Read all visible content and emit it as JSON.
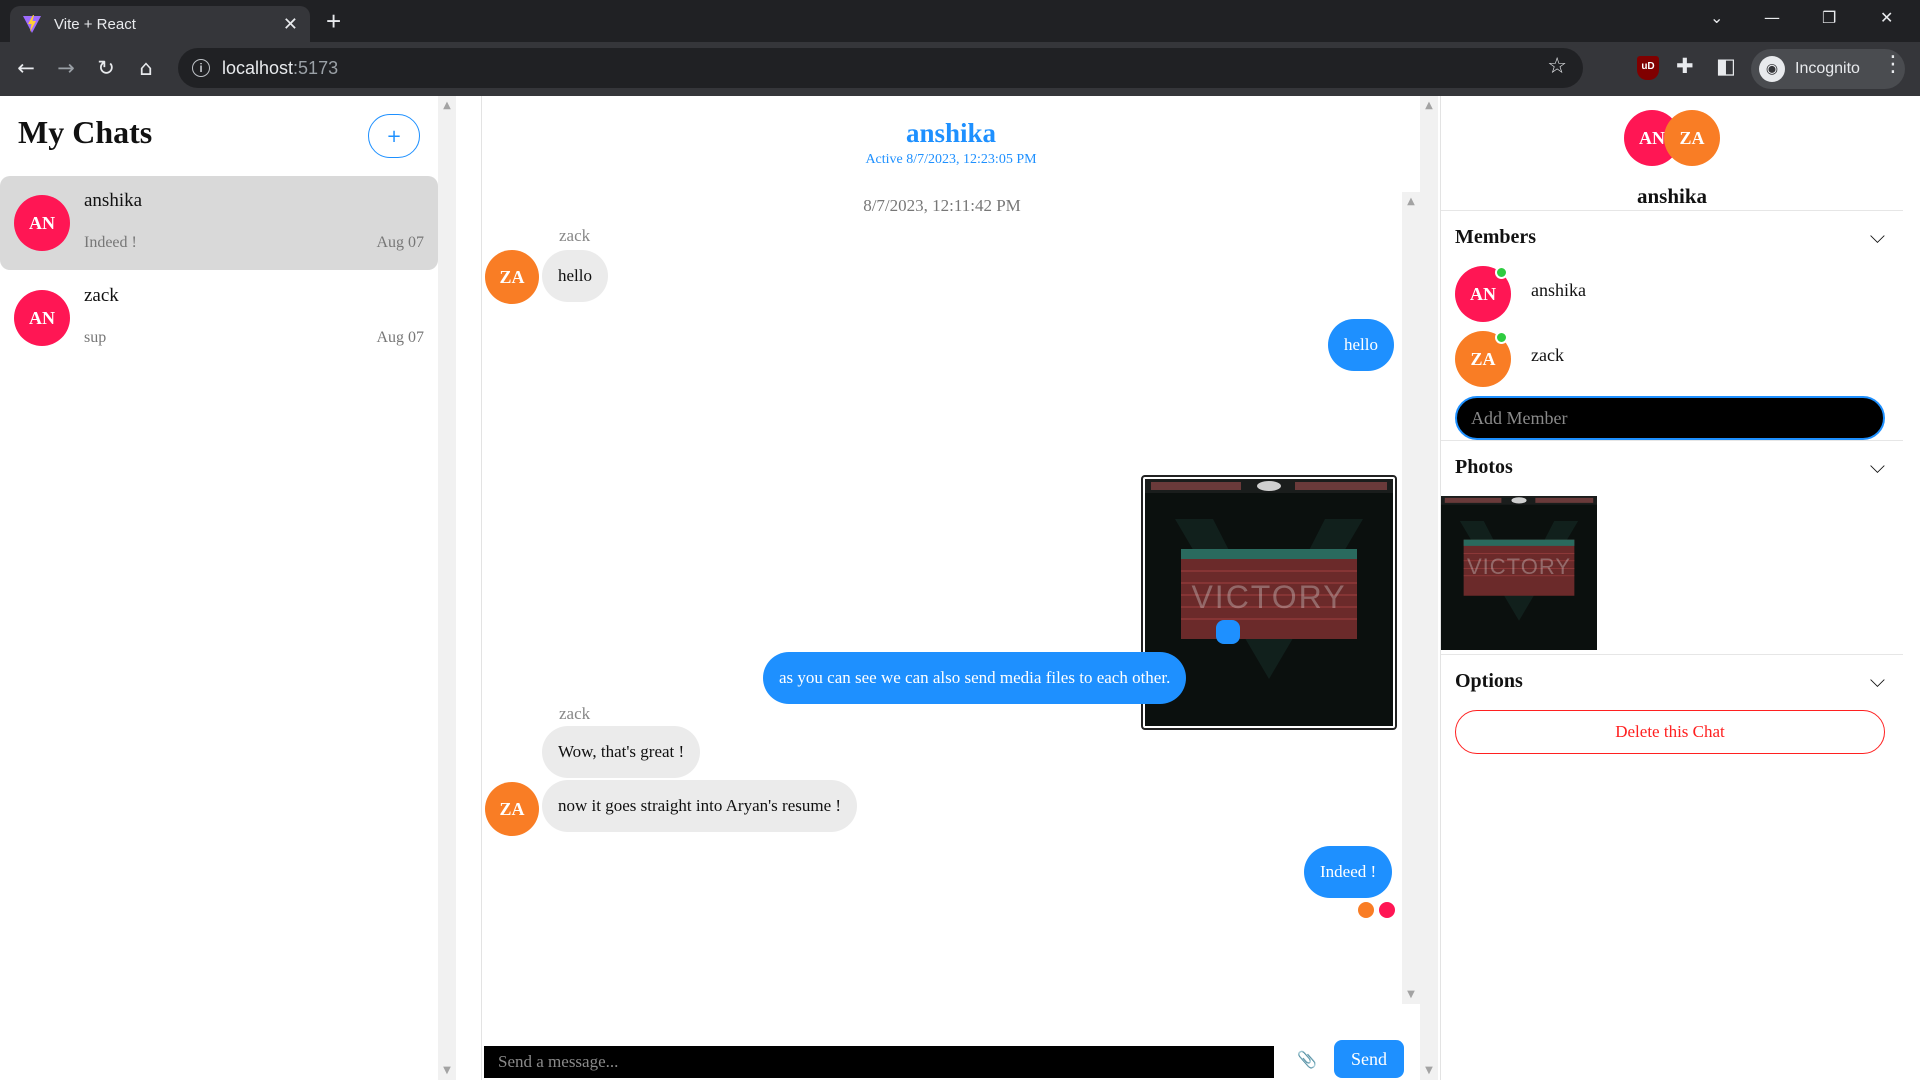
{
  "browser": {
    "tab_title": "Vite + React",
    "url_host": "localhost",
    "url_port": ":5173",
    "profile_label": "Incognito",
    "ublock_label": "uD"
  },
  "left": {
    "title": "My Chats",
    "add_label": "+",
    "chats": [
      {
        "initials": "AN",
        "name": "anshika",
        "last_message": "Indeed !",
        "date": "Aug 07",
        "avatar_color": "#ff1654",
        "active": true
      },
      {
        "initials": "AN",
        "name": "zack",
        "last_message": "sup",
        "date": "Aug 07",
        "avatar_color": "#ff1654",
        "active": false
      }
    ]
  },
  "chat": {
    "name": "anshika",
    "status": "Active 8/7/2023, 12:23:05 PM",
    "timestamp": "8/7/2023, 12:11:42 PM",
    "messages": [
      {
        "direction": "in",
        "sender": "zack",
        "initials": "ZA",
        "text": "hello"
      },
      {
        "direction": "out",
        "text": "hello"
      },
      {
        "direction": "out",
        "type": "image",
        "alt_text": "VICTORY"
      },
      {
        "direction": "out",
        "text": ""
      },
      {
        "direction": "out",
        "text": "as you can see we can also send media files to each other."
      },
      {
        "direction": "in",
        "sender": "zack",
        "text": "Wow, that's great !"
      },
      {
        "direction": "in",
        "initials": "ZA",
        "text": "now it goes straight into Aryan's resume !"
      },
      {
        "direction": "out",
        "text": "Indeed !"
      }
    ],
    "input_placeholder": "Send a message...",
    "send_label": "Send"
  },
  "details": {
    "avatars": [
      "AN",
      "ZA"
    ],
    "name": "anshika",
    "members_heading": "Members",
    "members": [
      {
        "initials": "AN",
        "name": "anshika",
        "color": "#ff1654",
        "online": true
      },
      {
        "initials": "ZA",
        "name": "zack",
        "color": "#f97d25",
        "online": true
      }
    ],
    "add_member_placeholder": "Add Member",
    "photos_heading": "Photos",
    "photo_text": "VICTORY",
    "options_heading": "Options",
    "delete_label": "Delete this Chat"
  },
  "colors": {
    "accent": "#1e90ff",
    "an_avatar": "#ff1654",
    "za_avatar": "#f97d25",
    "danger": "#ff2020",
    "online": "#2ecc40"
  }
}
